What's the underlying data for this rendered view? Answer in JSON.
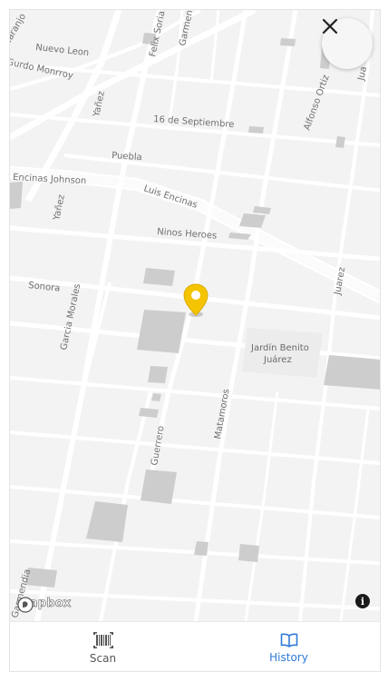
{
  "map": {
    "streets": {
      "naranjo": "Naranjo",
      "nuevo_leon": "Nuevo Leon",
      "guardo_monrroy": "Gurdo Monrroy",
      "felix_soria": "Felix Soria",
      "garmendia_top": "Garmen",
      "yanez_top": "Yañez",
      "dieciseis": "16 de Septiembre",
      "alfonso_ortiz": "Alfonso Ortiz",
      "juarez_top": "Jua",
      "puebla": "Puebla",
      "encinas_johnson": "Encinas Johnson",
      "luis_encinas": "Luis Encinas",
      "yanez_mid": "Yañez",
      "ninos_heroes": "Ninos Heroes",
      "juarez": "Juarez",
      "sonora": "Sonora",
      "garcia_morales": "Garcia Morales",
      "matamoros": "Matamoros",
      "guerrero": "Guerrero",
      "garmendia_bottom": "Garmendia"
    },
    "park_label_line1": "Jardín Benito",
    "park_label_line2": "Juárez",
    "marker_color": "#f5c400",
    "attribution": "mapbox",
    "info_glyph": "i"
  },
  "close_icon": "close-icon",
  "tabs": [
    {
      "label": "Scan",
      "icon": "barcode-icon",
      "active": false
    },
    {
      "label": "History",
      "icon": "open-book-icon",
      "active": true
    }
  ],
  "colors": {
    "active_tab": "#2f7ad8",
    "inactive_tab": "#555555"
  }
}
